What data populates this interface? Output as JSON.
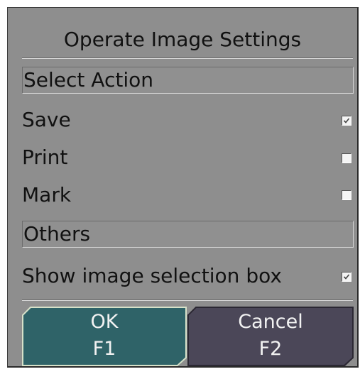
{
  "dialog": {
    "title": "Operate Image Settings",
    "sections": {
      "select_action": {
        "header": "Select Action",
        "options": [
          {
            "label": "Save",
            "checked": true
          },
          {
            "label": "Print",
            "checked": false
          },
          {
            "label": "Mark",
            "checked": false
          }
        ]
      },
      "others": {
        "header": "Others",
        "options": [
          {
            "label": "Show image selection box",
            "checked": true
          }
        ]
      }
    },
    "buttons": {
      "ok": {
        "label": "OK",
        "shortcut": "F1",
        "color": "#2f6368"
      },
      "cancel": {
        "label": "Cancel",
        "shortcut": "F2",
        "color": "#4b4758"
      }
    },
    "background_color": "#8e8e8e"
  }
}
